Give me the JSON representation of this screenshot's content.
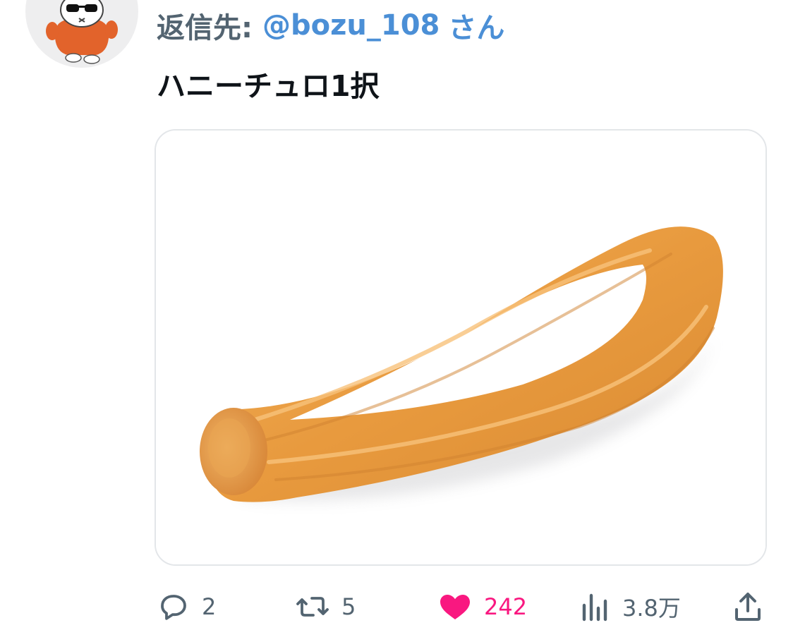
{
  "reply": {
    "prefix": "返信先:",
    "handle": "@bozu_108",
    "suffix": "さん"
  },
  "tweet": {
    "text": "ハニーチュロ1択"
  },
  "actions": {
    "reply_count": "2",
    "retweet_count": "5",
    "like_count": "242",
    "view_count": "3.8万"
  },
  "colors": {
    "link": "#4b8fd6",
    "like": "#f91880",
    "muted": "#536471"
  },
  "icons": {
    "reply": "reply-icon",
    "retweet": "retweet-icon",
    "like": "heart-icon",
    "views": "views-icon",
    "share": "share-icon"
  }
}
